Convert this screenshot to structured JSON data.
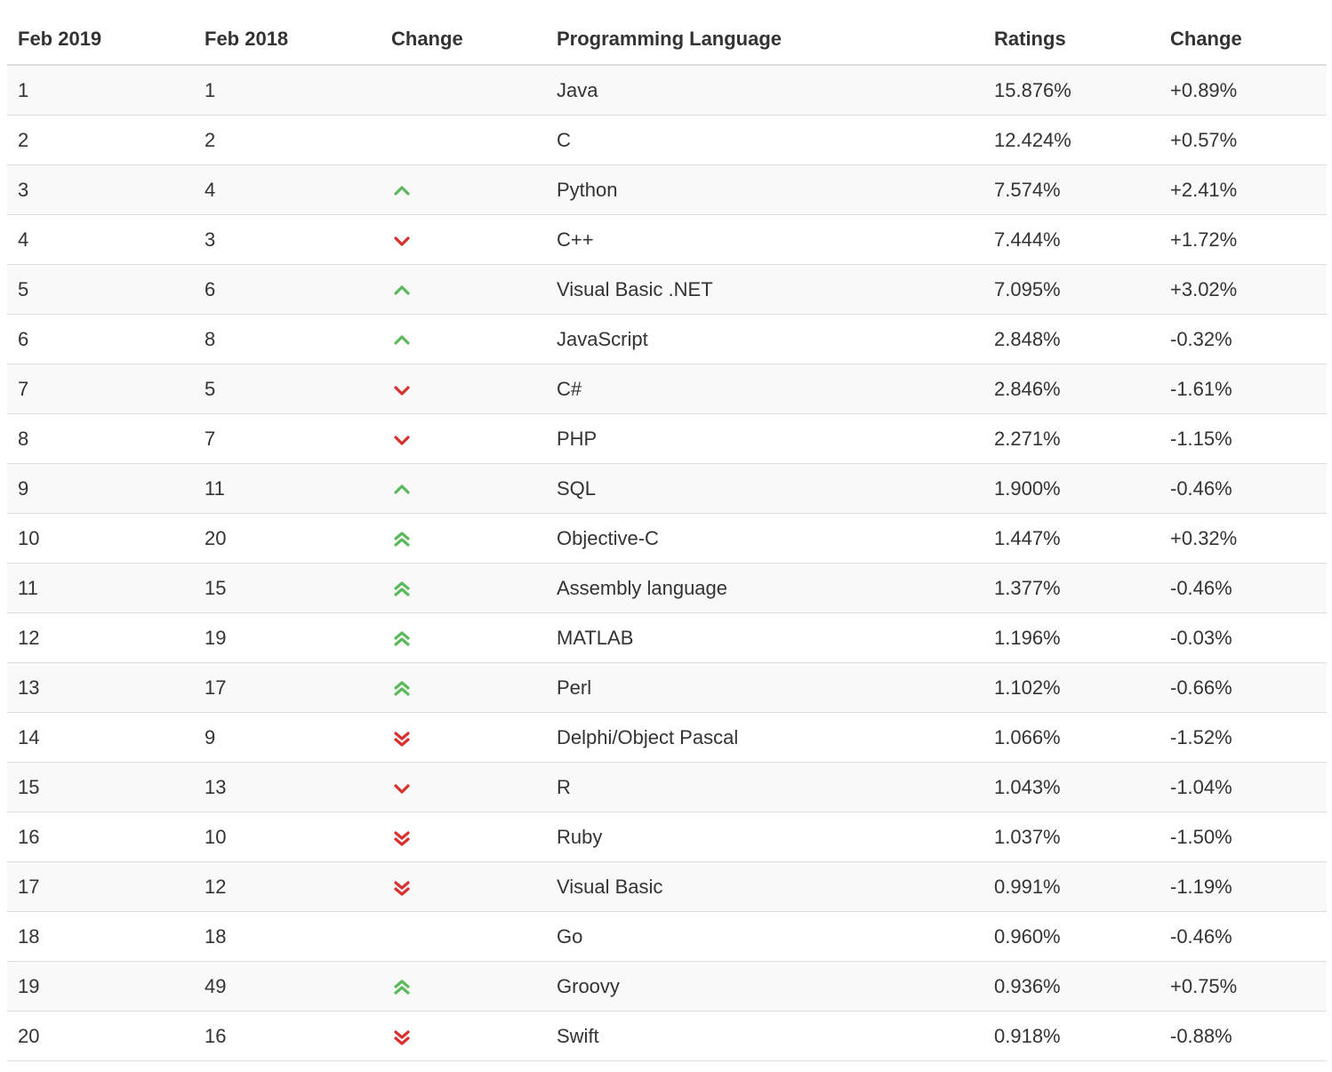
{
  "headers": [
    "Feb 2019",
    "Feb 2018",
    "Change",
    "Programming Language",
    "Ratings",
    "Change"
  ],
  "colors": {
    "up": "#5cb85c",
    "down": "#d9302c",
    "row_alt": "#f9f9f9",
    "border": "#dddddd"
  },
  "rows": [
    {
      "rank_2019": "1",
      "rank_2018": "1",
      "trend_icon": "",
      "language": "Java",
      "rating": "15.876%",
      "change": "+0.89%"
    },
    {
      "rank_2019": "2",
      "rank_2018": "2",
      "trend_icon": "",
      "language": "C",
      "rating": "12.424%",
      "change": "+0.57%"
    },
    {
      "rank_2019": "3",
      "rank_2018": "4",
      "trend_icon": "chevron-up-icon",
      "language": "Python",
      "rating": "7.574%",
      "change": "+2.41%"
    },
    {
      "rank_2019": "4",
      "rank_2018": "3",
      "trend_icon": "chevron-down-icon",
      "language": "C++",
      "rating": "7.444%",
      "change": "+1.72%"
    },
    {
      "rank_2019": "5",
      "rank_2018": "6",
      "trend_icon": "chevron-up-icon",
      "language": "Visual Basic .NET",
      "rating": "7.095%",
      "change": "+3.02%"
    },
    {
      "rank_2019": "6",
      "rank_2018": "8",
      "trend_icon": "chevron-up-icon",
      "language": "JavaScript",
      "rating": "2.848%",
      "change": "-0.32%"
    },
    {
      "rank_2019": "7",
      "rank_2018": "5",
      "trend_icon": "chevron-down-icon",
      "language": "C#",
      "rating": "2.846%",
      "change": "-1.61%"
    },
    {
      "rank_2019": "8",
      "rank_2018": "7",
      "trend_icon": "chevron-down-icon",
      "language": "PHP",
      "rating": "2.271%",
      "change": "-1.15%"
    },
    {
      "rank_2019": "9",
      "rank_2018": "11",
      "trend_icon": "chevron-up-icon",
      "language": "SQL",
      "rating": "1.900%",
      "change": "-0.46%"
    },
    {
      "rank_2019": "10",
      "rank_2018": "20",
      "trend_icon": "double-chevron-up-icon",
      "language": "Objective-C",
      "rating": "1.447%",
      "change": "+0.32%"
    },
    {
      "rank_2019": "11",
      "rank_2018": "15",
      "trend_icon": "double-chevron-up-icon",
      "language": "Assembly language",
      "rating": "1.377%",
      "change": "-0.46%"
    },
    {
      "rank_2019": "12",
      "rank_2018": "19",
      "trend_icon": "double-chevron-up-icon",
      "language": "MATLAB",
      "rating": "1.196%",
      "change": "-0.03%"
    },
    {
      "rank_2019": "13",
      "rank_2018": "17",
      "trend_icon": "double-chevron-up-icon",
      "language": "Perl",
      "rating": "1.102%",
      "change": "-0.66%"
    },
    {
      "rank_2019": "14",
      "rank_2018": "9",
      "trend_icon": "double-chevron-down-icon",
      "language": "Delphi/Object Pascal",
      "rating": "1.066%",
      "change": "-1.52%"
    },
    {
      "rank_2019": "15",
      "rank_2018": "13",
      "trend_icon": "chevron-down-icon",
      "language": "R",
      "rating": "1.043%",
      "change": "-1.04%"
    },
    {
      "rank_2019": "16",
      "rank_2018": "10",
      "trend_icon": "double-chevron-down-icon",
      "language": "Ruby",
      "rating": "1.037%",
      "change": "-1.50%"
    },
    {
      "rank_2019": "17",
      "rank_2018": "12",
      "trend_icon": "double-chevron-down-icon",
      "language": "Visual Basic",
      "rating": "0.991%",
      "change": "-1.19%"
    },
    {
      "rank_2019": "18",
      "rank_2018": "18",
      "trend_icon": "",
      "language": "Go",
      "rating": "0.960%",
      "change": "-0.46%"
    },
    {
      "rank_2019": "19",
      "rank_2018": "49",
      "trend_icon": "double-chevron-up-icon",
      "language": "Groovy",
      "rating": "0.936%",
      "change": "+0.75%"
    },
    {
      "rank_2019": "20",
      "rank_2018": "16",
      "trend_icon": "double-chevron-down-icon",
      "language": "Swift",
      "rating": "0.918%",
      "change": "-0.88%"
    }
  ]
}
